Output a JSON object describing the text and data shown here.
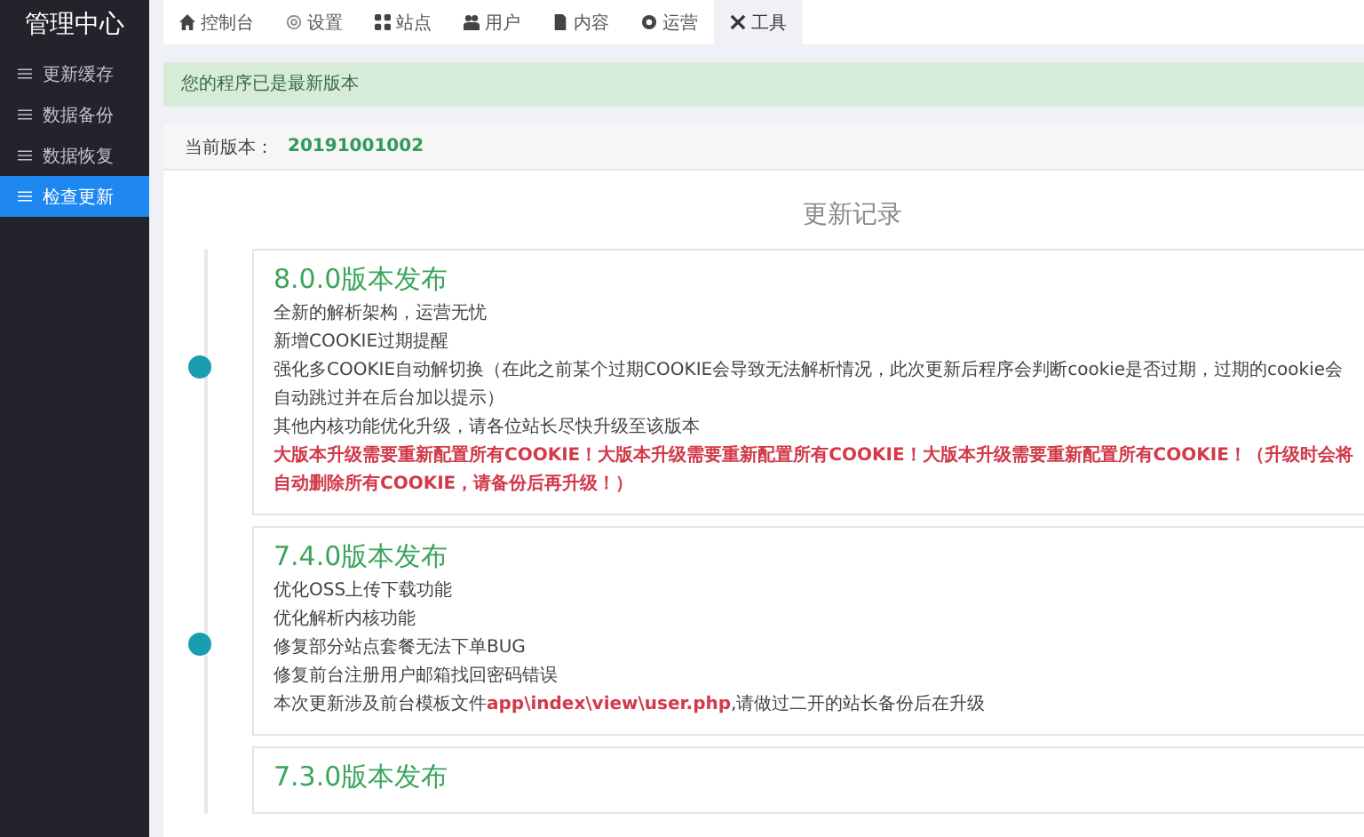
{
  "sidebar": {
    "title": "管理中心",
    "items": [
      {
        "label": "更新缓存",
        "selected": false
      },
      {
        "label": "数据备份",
        "selected": false
      },
      {
        "label": "数据恢复",
        "selected": false
      },
      {
        "label": "检查更新",
        "selected": true
      }
    ]
  },
  "tabs": [
    {
      "label": "控制台",
      "selected": false
    },
    {
      "label": "设置",
      "selected": false
    },
    {
      "label": "站点",
      "selected": false
    },
    {
      "label": "用户",
      "selected": false
    },
    {
      "label": "内容",
      "selected": false
    },
    {
      "label": "运营",
      "selected": false
    },
    {
      "label": "工具",
      "selected": true
    }
  ],
  "alert": "您的程序已是最新版本",
  "version": {
    "label": "当前版本：",
    "value": "20191001002"
  },
  "heading": "更新记录",
  "releases": [
    {
      "title": "8.0.0版本发布",
      "lines": [
        {
          "kind": "normal",
          "text": "全新的解析架构，运营无忧"
        },
        {
          "kind": "normal",
          "text": "新增COOKIE过期提醒"
        },
        {
          "kind": "normal",
          "text": "强化多COOKIE自动解切换（在此之前某个过期COOKIE会导致无法解析情况，此次更新后程序会判断cookie是否过期，过期的cookie会自动跳过并在后台加以提示）"
        },
        {
          "kind": "normal",
          "text": "其他内核功能优化升级，请各位站长尽快升级至该版本"
        },
        {
          "kind": "warning",
          "text": "大版本升级需要重新配置所有COOKIE！大版本升级需要重新配置所有COOKIE！大版本升级需要重新配置所有COOKIE！（升级时会将自动删除所有COOKIE，请备份后再升级！）"
        }
      ]
    },
    {
      "title": "7.4.0版本发布",
      "lines": [
        {
          "kind": "normal",
          "text": "优化OSS上传下载功能"
        },
        {
          "kind": "normal",
          "text": "优化解析内核功能"
        },
        {
          "kind": "normal",
          "text": "修复部分站点套餐无法下单BUG"
        },
        {
          "kind": "normal",
          "text": "修复前台注册用户邮箱找回密码错误"
        },
        {
          "kind": "normal",
          "text": "本次更新涉及前台模板文件**app\\index\\view\\user.php**,请做过二开的站长备份后在升级"
        }
      ]
    },
    {
      "title": "7.3.0版本发布"
    }
  ]
}
